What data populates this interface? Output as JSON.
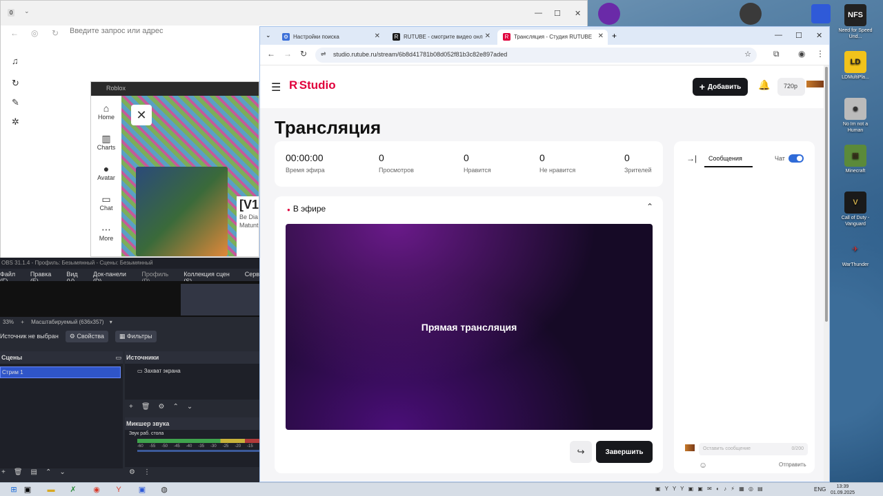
{
  "desktop": {
    "icons": [
      {
        "label": "Need for Speed Und...",
        "icon": "nfs-icon",
        "abbr": "NFS"
      },
      {
        "label": "LDMultiPla...",
        "icon": "ldplayer-icon",
        "abbr": "LD"
      },
      {
        "label": "No Im not a Human",
        "icon": "game-face-icon",
        "abbr": "☻"
      },
      {
        "label": "Minecraft",
        "icon": "minecraft-icon",
        "abbr": "▦"
      },
      {
        "label": "Call of Duty - Vanguard",
        "icon": "cod-icon",
        "abbr": "V"
      },
      {
        "label": "WarThunder",
        "icon": "warthunder-icon",
        "abbr": "✈"
      }
    ]
  },
  "bg_browser": {
    "address_placeholder": "Введите запрос или адрес",
    "tab_badge": "0"
  },
  "roblox": {
    "window_title": "Roblox",
    "nav": [
      {
        "label": "Home",
        "icon": "home-icon",
        "glyph": "⌂"
      },
      {
        "label": "Charts",
        "icon": "charts-icon",
        "glyph": "▥"
      },
      {
        "label": "Avatar",
        "icon": "avatar-icon",
        "glyph": "●"
      },
      {
        "label": "Chat",
        "icon": "chat-icon",
        "glyph": "▭"
      },
      {
        "label": "More",
        "icon": "more-icon",
        "glyph": "⋯"
      }
    ],
    "game_title": "[V1:",
    "game_sub1": "Be Dia",
    "game_sub2": "Matunt"
  },
  "obs": {
    "title": "OBS 31.1.4 - Профиль: Безымянный - Сцены: Безымянный",
    "menu": [
      "Файл (F)",
      "Правка (E)",
      "Вид (V)",
      "Док-панели (D)",
      "Профиль (P)",
      "Коллекция сцен (S)",
      "Серв"
    ],
    "zoom": "33%",
    "scale": "Масштабируемый (636x357)",
    "no_source": "Источник не выбран",
    "properties": "Свойства",
    "filters": "Фильтры",
    "scenes_header": "Сцены",
    "scene_selected": "Стрим 1",
    "sources_header": "Источники",
    "source_item": "Захват экрана",
    "mixer_header": "Микшер звука",
    "mixer_track": "Звук раб. стола",
    "ticks": [
      "-60",
      "-55",
      "-50",
      "-45",
      "-40",
      "-35",
      "-30",
      "-25",
      "-20",
      "-15"
    ],
    "meter_colors": {
      "green": "#3fa34d",
      "yellow": "#c8b23a",
      "red": "#b03a3a"
    }
  },
  "chrome": {
    "tabs": [
      {
        "title": "Настройки поиска",
        "icon": "gear-icon",
        "color": "#3b6fd8"
      },
      {
        "title": "RUTUBE - смотрите видео онл",
        "icon": "rutube-icon",
        "color": "#1a1a1a"
      },
      {
        "title": "Трансляция - Студия RUTUBE",
        "icon": "rutube-icon",
        "color": "#e0003c"
      }
    ],
    "url": "studio.rutube.ru/stream/6b8d41781b08d052f81b3c82e897aded"
  },
  "studio": {
    "logo_r": "R",
    "logo_text": "Studio",
    "add_label": "Добавить",
    "quality": "720p",
    "page_title": "Трансляция",
    "stats": [
      {
        "value": "00:00:00",
        "label": "Время эфира"
      },
      {
        "value": "0",
        "label": "Просмотров"
      },
      {
        "value": "0",
        "label": "Нравится"
      },
      {
        "value": "0",
        "label": "Не нравится"
      },
      {
        "value": "0",
        "label": "Зрителей"
      }
    ],
    "live_label": "В эфире",
    "player_text": "Прямая трансляция",
    "finish_label": "Завершить",
    "chat": {
      "tab_messages": "Сообщения",
      "chat_label": "Чат",
      "chat_enabled": true,
      "input_placeholder": "Оставить сообщение",
      "counter": "0/200",
      "send_label": "Отправить"
    },
    "accent": "#e0003c"
  },
  "taskbar": {
    "lang": "ENG",
    "time": "13:39",
    "date": "01.09.2025"
  }
}
